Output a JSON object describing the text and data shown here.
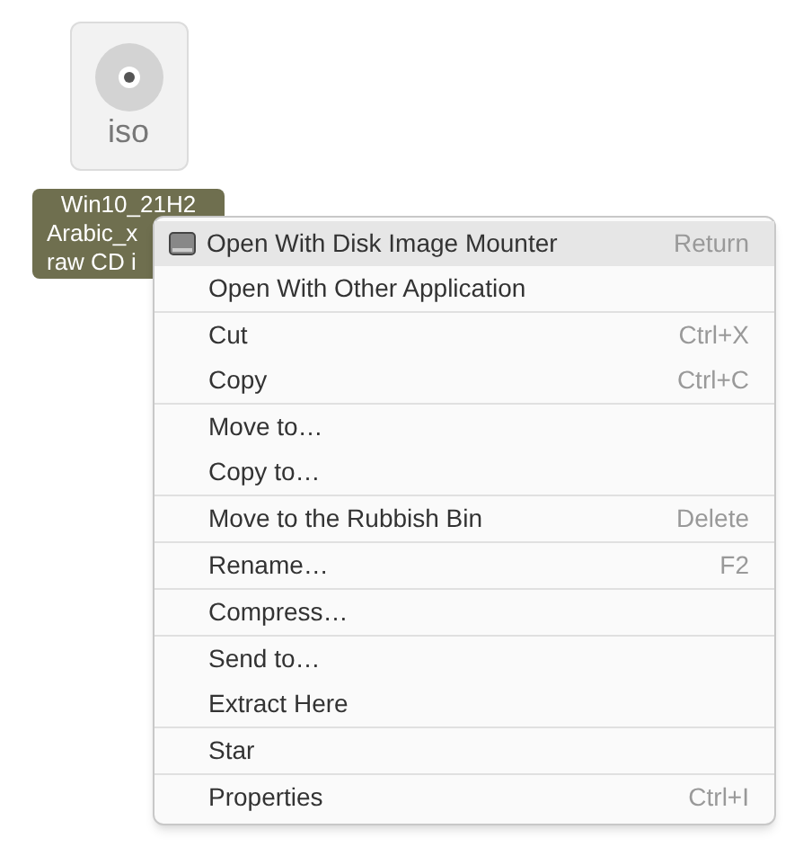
{
  "file": {
    "type_label": "iso",
    "name_lines": [
      "Win10_21H2",
      "Arabic_x",
      "raw CD i"
    ],
    "selected": true
  },
  "context_menu": {
    "groups": [
      {
        "items": [
          {
            "label": "Open With Disk Image Mounter",
            "shortcut": "Return",
            "kind": "app",
            "selected": true
          },
          {
            "label": "Open With Other Application",
            "selected": false
          }
        ]
      },
      {
        "items": [
          {
            "label": "Cut",
            "shortcut": "Ctrl+X",
            "selected": false
          },
          {
            "label": "Copy",
            "shortcut": "Ctrl+C",
            "selected": false
          }
        ]
      },
      {
        "items": [
          {
            "label": "Move to…",
            "selected": false
          },
          {
            "label": "Copy to…",
            "selected": false
          }
        ]
      },
      {
        "items": [
          {
            "label": "Move to the Rubbish Bin",
            "shortcut": "Delete",
            "selected": false
          }
        ]
      },
      {
        "items": [
          {
            "label": "Rename…",
            "shortcut": "F2",
            "selected": false
          }
        ]
      },
      {
        "items": [
          {
            "label": "Compress…",
            "selected": false
          }
        ]
      },
      {
        "items": [
          {
            "label": "Send to…",
            "selected": false
          },
          {
            "label": "Extract Here",
            "selected": false
          }
        ]
      },
      {
        "items": [
          {
            "label": "Star",
            "selected": false
          }
        ]
      },
      {
        "items": [
          {
            "label": "Properties",
            "shortcut": "Ctrl+I",
            "selected": false
          }
        ]
      }
    ]
  }
}
